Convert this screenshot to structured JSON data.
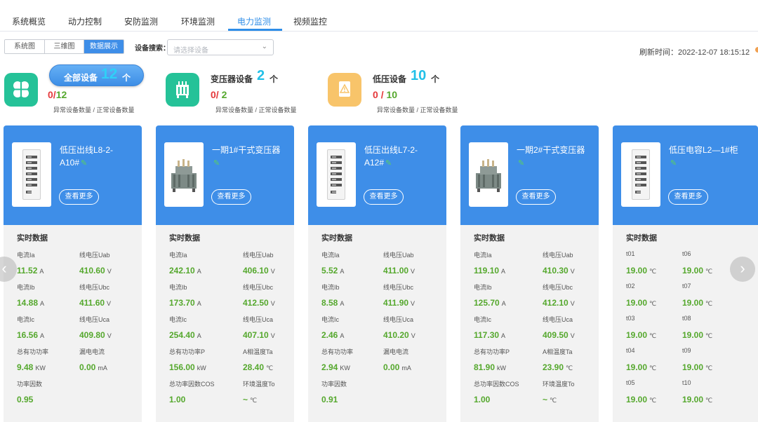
{
  "nav": {
    "tabs": [
      "系统概览",
      "动力控制",
      "安防监测",
      "环境监测",
      "电力监测",
      "视频监控"
    ],
    "active": "电力监测"
  },
  "toolbar": {
    "views": [
      "系统图",
      "三维图",
      "数据展示"
    ],
    "active_view": "数据展示",
    "search_label": "设备搜索：",
    "search_placeholder": "请选择设备",
    "refresh_label": "刷新时间：2022-12-07 18:15:12"
  },
  "summary": {
    "all": {
      "title": "全部设备",
      "count": "12",
      "unit": "个",
      "abnormal": "0",
      "normal": "12"
    },
    "transformer": {
      "title": "变压器设备",
      "count": "2",
      "unit": "个",
      "abnormal": "0",
      "normal": "2"
    },
    "lowvoltage": {
      "title": "低压设备",
      "count": "10",
      "unit": "个",
      "abnormal": "0",
      "normal": "10"
    },
    "legend": "异常设备数量 / 正常设备数量",
    "separator": "/"
  },
  "cards": [
    {
      "name": "低压出线L8-2-A10#",
      "image": "cabinet-icon",
      "more": "查看更多",
      "section": "实时数据",
      "rows": [
        [
          {
            "label": "电流Ia",
            "value": "11.52",
            "unit": "A"
          },
          {
            "label": "线电压Uab",
            "value": "410.60",
            "unit": "V"
          }
        ],
        [
          {
            "label": "电流Ib",
            "value": "14.88",
            "unit": "A"
          },
          {
            "label": "线电压Ubc",
            "value": "411.60",
            "unit": "V"
          }
        ],
        [
          {
            "label": "电流Ic",
            "value": "16.56",
            "unit": "A"
          },
          {
            "label": "线电压Uca",
            "value": "409.80",
            "unit": "V"
          }
        ],
        [
          {
            "label": "总有功功率",
            "value": "9.48",
            "unit": "KW"
          },
          {
            "label": "漏电电流",
            "value": "0.00",
            "unit": "mA"
          }
        ],
        [
          {
            "label": "功率因数",
            "value": "0.95",
            "unit": ""
          }
        ]
      ]
    },
    {
      "name": "一期1#干式变压器",
      "image": "transformer-icon",
      "more": "查看更多",
      "section": "实时数据",
      "rows": [
        [
          {
            "label": "电流Ia",
            "value": "242.10",
            "unit": "A"
          },
          {
            "label": "线电压Uab",
            "value": "406.10",
            "unit": "V"
          }
        ],
        [
          {
            "label": "电流Ib",
            "value": "173.70",
            "unit": "A"
          },
          {
            "label": "线电压Ubc",
            "value": "412.50",
            "unit": "V"
          }
        ],
        [
          {
            "label": "电流Ic",
            "value": "254.40",
            "unit": "A"
          },
          {
            "label": "线电压Uca",
            "value": "407.10",
            "unit": "V"
          }
        ],
        [
          {
            "label": "总有功功率P",
            "value": "156.00",
            "unit": "kW"
          },
          {
            "label": "A相温度Ta",
            "value": "28.40",
            "unit": "℃"
          }
        ],
        [
          {
            "label": "总功率因数COS",
            "value": "1.00",
            "unit": ""
          },
          {
            "label": "环境温度To",
            "value": "~",
            "unit": "℃"
          }
        ]
      ]
    },
    {
      "name": "低压出线L7-2-A12#",
      "image": "cabinet-icon",
      "more": "查看更多",
      "section": "实时数据",
      "rows": [
        [
          {
            "label": "电流Ia",
            "value": "5.52",
            "unit": "A"
          },
          {
            "label": "线电压Uab",
            "value": "411.00",
            "unit": "V"
          }
        ],
        [
          {
            "label": "电流Ib",
            "value": "8.58",
            "unit": "A"
          },
          {
            "label": "线电压Ubc",
            "value": "411.90",
            "unit": "V"
          }
        ],
        [
          {
            "label": "电流Ic",
            "value": "2.46",
            "unit": "A"
          },
          {
            "label": "线电压Uca",
            "value": "410.20",
            "unit": "V"
          }
        ],
        [
          {
            "label": "总有功功率",
            "value": "2.94",
            "unit": "KW"
          },
          {
            "label": "漏电电流",
            "value": "0.00",
            "unit": "mA"
          }
        ],
        [
          {
            "label": "功率因数",
            "value": "0.91",
            "unit": ""
          }
        ]
      ]
    },
    {
      "name": "一期2#干式变压器",
      "image": "transformer-icon",
      "more": "查看更多",
      "section": "实时数据",
      "rows": [
        [
          {
            "label": "电流Ia",
            "value": "119.10",
            "unit": "A"
          },
          {
            "label": "线电压Uab",
            "value": "410.30",
            "unit": "V"
          }
        ],
        [
          {
            "label": "电流Ib",
            "value": "125.70",
            "unit": "A"
          },
          {
            "label": "线电压Ubc",
            "value": "412.10",
            "unit": "V"
          }
        ],
        [
          {
            "label": "电流Ic",
            "value": "117.30",
            "unit": "A"
          },
          {
            "label": "线电压Uca",
            "value": "409.50",
            "unit": "V"
          }
        ],
        [
          {
            "label": "总有功功率P",
            "value": "81.90",
            "unit": "kW"
          },
          {
            "label": "A相温度Ta",
            "value": "23.90",
            "unit": "℃"
          }
        ],
        [
          {
            "label": "总功率因数COS",
            "value": "1.00",
            "unit": ""
          },
          {
            "label": "环境温度To",
            "value": "~",
            "unit": "℃"
          }
        ]
      ]
    },
    {
      "name": "低压电容L2—1#柜",
      "image": "cabinet-icon",
      "more": "查看更多",
      "section": "实时数据",
      "rows": [
        [
          {
            "label": "t01",
            "value": "19.00",
            "unit": "℃"
          },
          {
            "label": "t06",
            "value": "19.00",
            "unit": "℃"
          }
        ],
        [
          {
            "label": "t02",
            "value": "19.00",
            "unit": "℃"
          },
          {
            "label": "t07",
            "value": "19.00",
            "unit": "℃"
          }
        ],
        [
          {
            "label": "t03",
            "value": "19.00",
            "unit": "℃"
          },
          {
            "label": "t08",
            "value": "19.00",
            "unit": "℃"
          }
        ],
        [
          {
            "label": "t04",
            "value": "19.00",
            "unit": "℃"
          },
          {
            "label": "t09",
            "value": "19.00",
            "unit": "℃"
          }
        ],
        [
          {
            "label": "t05",
            "value": "19.00",
            "unit": "℃"
          },
          {
            "label": "t10",
            "value": "19.00",
            "unit": "℃"
          }
        ]
      ]
    }
  ],
  "colors": {
    "accent": "#3e8ee8",
    "value_green": "#55a82d",
    "abnormal_red": "#e5383b",
    "count_cyan": "#22c0e8"
  },
  "icons": {
    "prev": "chevron-left-icon",
    "next": "chevron-right-icon",
    "link": "plug-icon"
  }
}
